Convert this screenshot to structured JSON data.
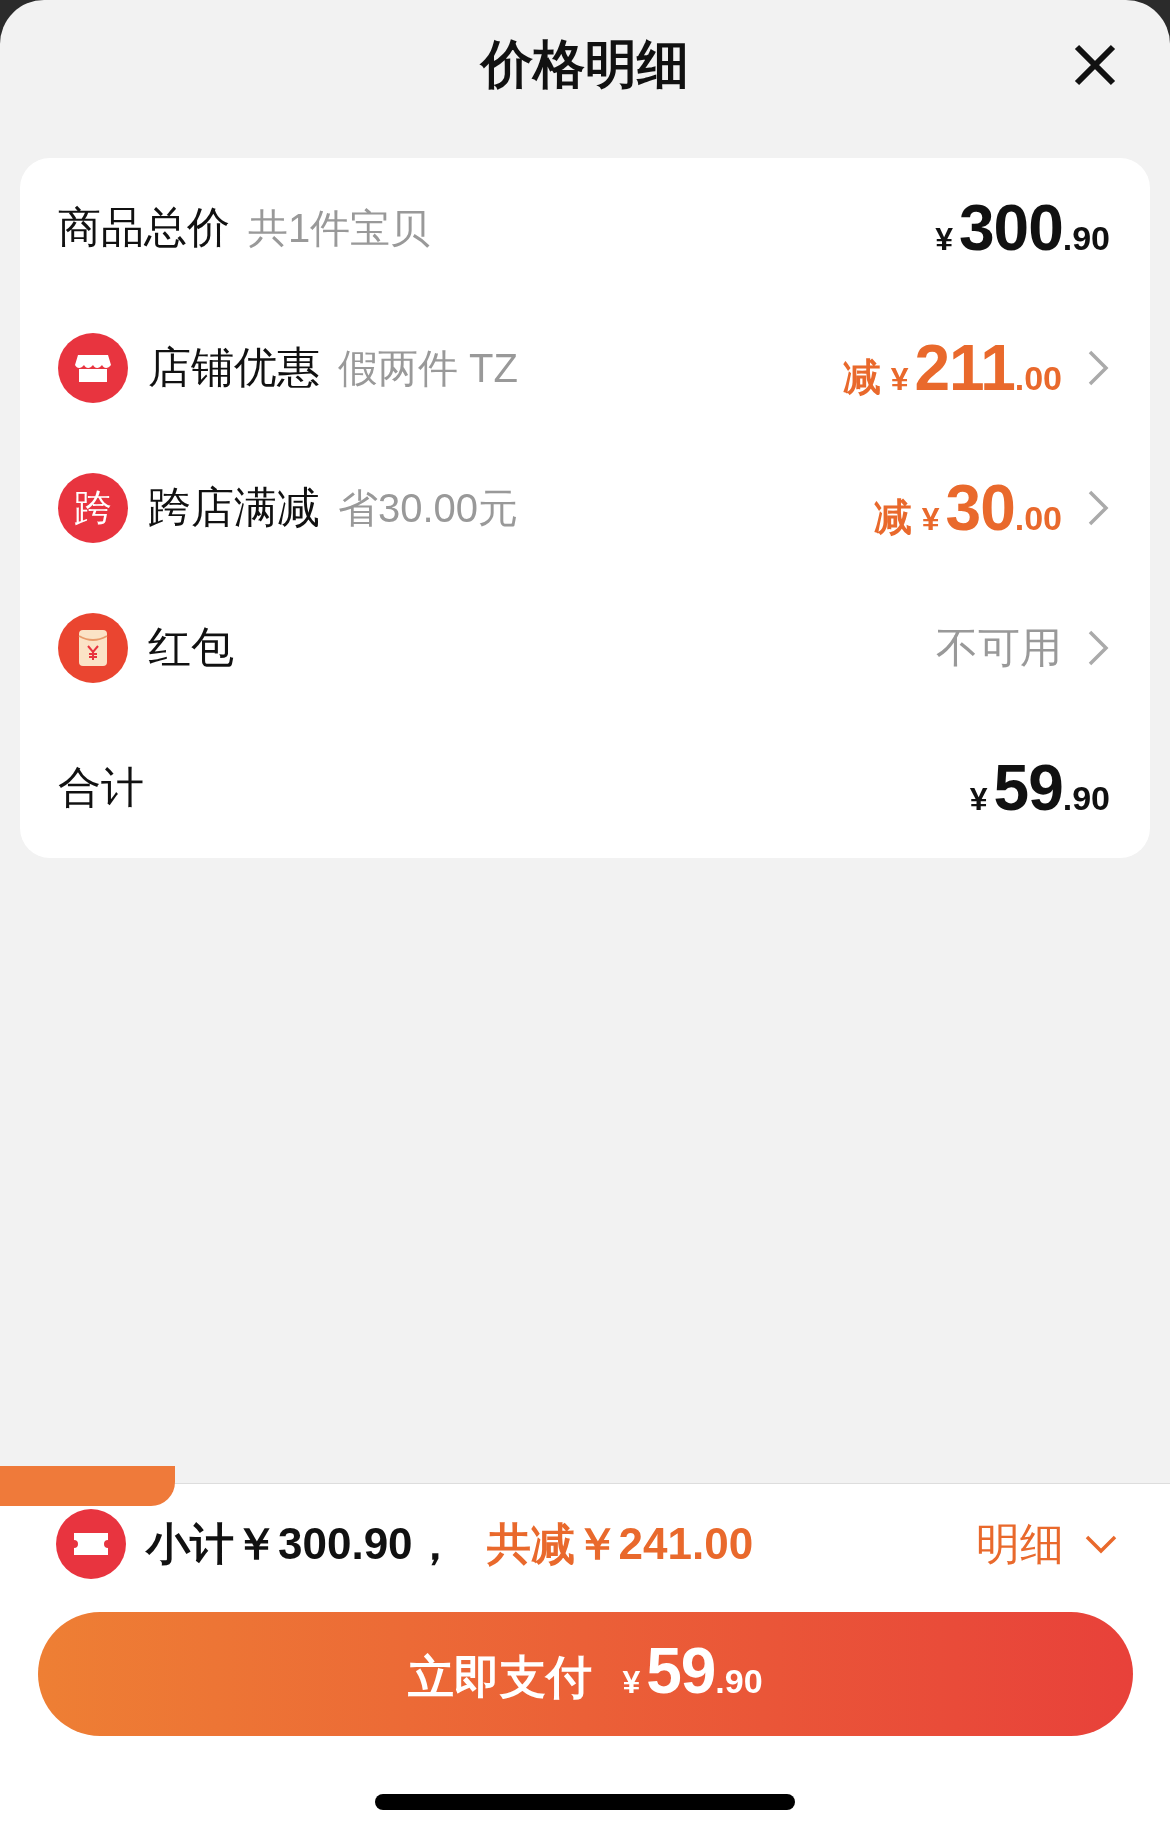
{
  "title": "价格明细",
  "summary": {
    "label": "商品总价",
    "note": "共1件宝贝",
    "currency": "¥",
    "integer": "300",
    "decimal": ".90"
  },
  "items": [
    {
      "kind": "shop_discount",
      "label": "店铺优惠",
      "note": "假两件 TZ",
      "prefix": "减",
      "currency": "¥",
      "integer": "211",
      "decimal": ".00"
    },
    {
      "kind": "cross_store",
      "badge": "跨",
      "label": "跨店满减",
      "note": "省30.00元",
      "prefix": "减",
      "currency": "¥",
      "integer": "30",
      "decimal": ".00"
    },
    {
      "kind": "red_packet",
      "label": "红包",
      "status": "不可用"
    }
  ],
  "total": {
    "label": "合计",
    "currency": "¥",
    "integer": "59",
    "decimal": ".90"
  },
  "footer": {
    "subtotal": "小计￥300.90，",
    "reduction": "共减￥241.00",
    "detail": "明细"
  },
  "pay_button": {
    "label": "立即支付",
    "currency": "¥",
    "integer": "59",
    "decimal": ".90"
  }
}
